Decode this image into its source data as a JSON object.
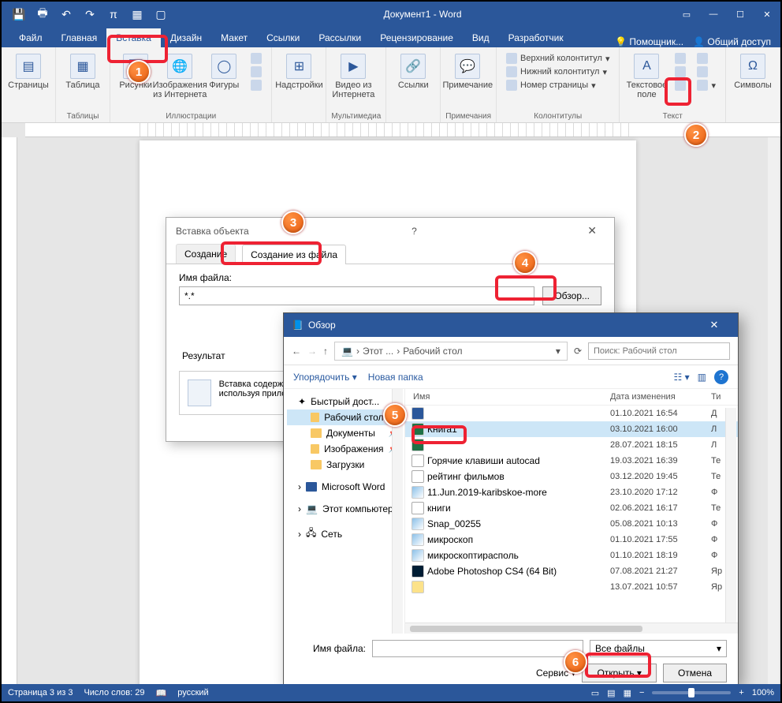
{
  "app": {
    "title": "Документ1 - Word"
  },
  "tabs": {
    "file": "Файл",
    "home": "Главная",
    "insert": "Вставка",
    "design": "Дизайн",
    "layout": "Макет",
    "refs": "Ссылки",
    "mail": "Рассылки",
    "review": "Рецензирование",
    "view": "Вид",
    "dev": "Разработчик",
    "tell": "Помощник...",
    "share": "Общий доступ"
  },
  "ribbon": {
    "pages": "Страницы",
    "tablesGroup": "Таблицы",
    "table": "Таблица",
    "illus": "Иллюстрации",
    "pic": "Рисунки",
    "online": "Изображения из Интернета",
    "shapes": "Фигуры",
    "addins": "Надстройки",
    "media": "Мультимедиа",
    "video": "Видео из Интернета",
    "links": "Ссылки",
    "comment": "Примечание",
    "comments": "Примечания",
    "hf": "Колонтитулы",
    "header": "Верхний колонтитул",
    "footer": "Нижний колонтитул",
    "pageno": "Номер страницы",
    "text": "Текст",
    "textbox": "Текстовое поле",
    "symbols": "Символы"
  },
  "dlg1": {
    "title": "Вставка объекта",
    "tabCreate": "Создание",
    "tabFile": "Создание из файла",
    "fnameLabel": "Имя файла:",
    "fnameValue": "*.*",
    "browse": "Обзор...",
    "resultLabel": "Результат",
    "resultText": "Вставка содержимого файла в документ так, чтобы его можно было редактировать, используя приложение, в котором он был создан."
  },
  "dlg2": {
    "title": "Обзор",
    "crumb1": "Этот ...",
    "crumb2": "Рабочий стол",
    "searchPh": "Поиск: Рабочий стол",
    "org": "Упорядочить",
    "newFolder": "Новая папка",
    "colName": "Имя",
    "colDate": "Дата изменения",
    "colType": "Ти",
    "quick": "Быстрый дост...",
    "desktop": "Рабочий стол",
    "docs": "Документы",
    "pics": "Изображения",
    "dl": "Загрузки",
    "msw": "Microsoft Word",
    "thispc": "Этот компьютер",
    "net": "Сеть",
    "fnameLabel": "Имя файла:",
    "allFiles": "Все файлы",
    "tools": "Сервис",
    "open": "Открыть",
    "cancel": "Отмена"
  },
  "files": [
    {
      "name": "",
      "date": "01.10.2021 16:54",
      "type": "Д",
      "ic": "word"
    },
    {
      "name": "Книга1",
      "date": "03.10.2021 16:00",
      "type": "Л",
      "ic": "excel",
      "sel": true
    },
    {
      "name": "",
      "date": "28.07.2021 18:15",
      "type": "Л",
      "ic": "excel"
    },
    {
      "name": "Горячие клавиши autocad",
      "date": "19.03.2021 16:39",
      "type": "Те",
      "ic": "txt"
    },
    {
      "name": "рейтинг фильмов",
      "date": "03.12.2020 19:45",
      "type": "Те",
      "ic": "txt"
    },
    {
      "name": "11.Jun.2019-karibskoe-more",
      "date": "23.10.2020 17:12",
      "type": "Ф",
      "ic": "img"
    },
    {
      "name": "книги",
      "date": "02.06.2021 16:17",
      "type": "Те",
      "ic": "txt"
    },
    {
      "name": "Snap_00255",
      "date": "05.08.2021 10:13",
      "type": "Ф",
      "ic": "img"
    },
    {
      "name": "микроскоп",
      "date": "01.10.2021 17:55",
      "type": "Ф",
      "ic": "img"
    },
    {
      "name": "микроскоптирасполь",
      "date": "01.10.2021 18:19",
      "type": "Ф",
      "ic": "img"
    },
    {
      "name": "Adobe Photoshop CS4 (64 Bit)",
      "date": "07.08.2021 21:27",
      "type": "Яр",
      "ic": "ps"
    },
    {
      "name": "",
      "date": "13.07.2021 10:57",
      "type": "Яр",
      "ic": "fold"
    }
  ],
  "status": {
    "page": "Страница 3 из 3",
    "words": "Число слов: 29",
    "lang": "русский",
    "zoom": "100%"
  }
}
